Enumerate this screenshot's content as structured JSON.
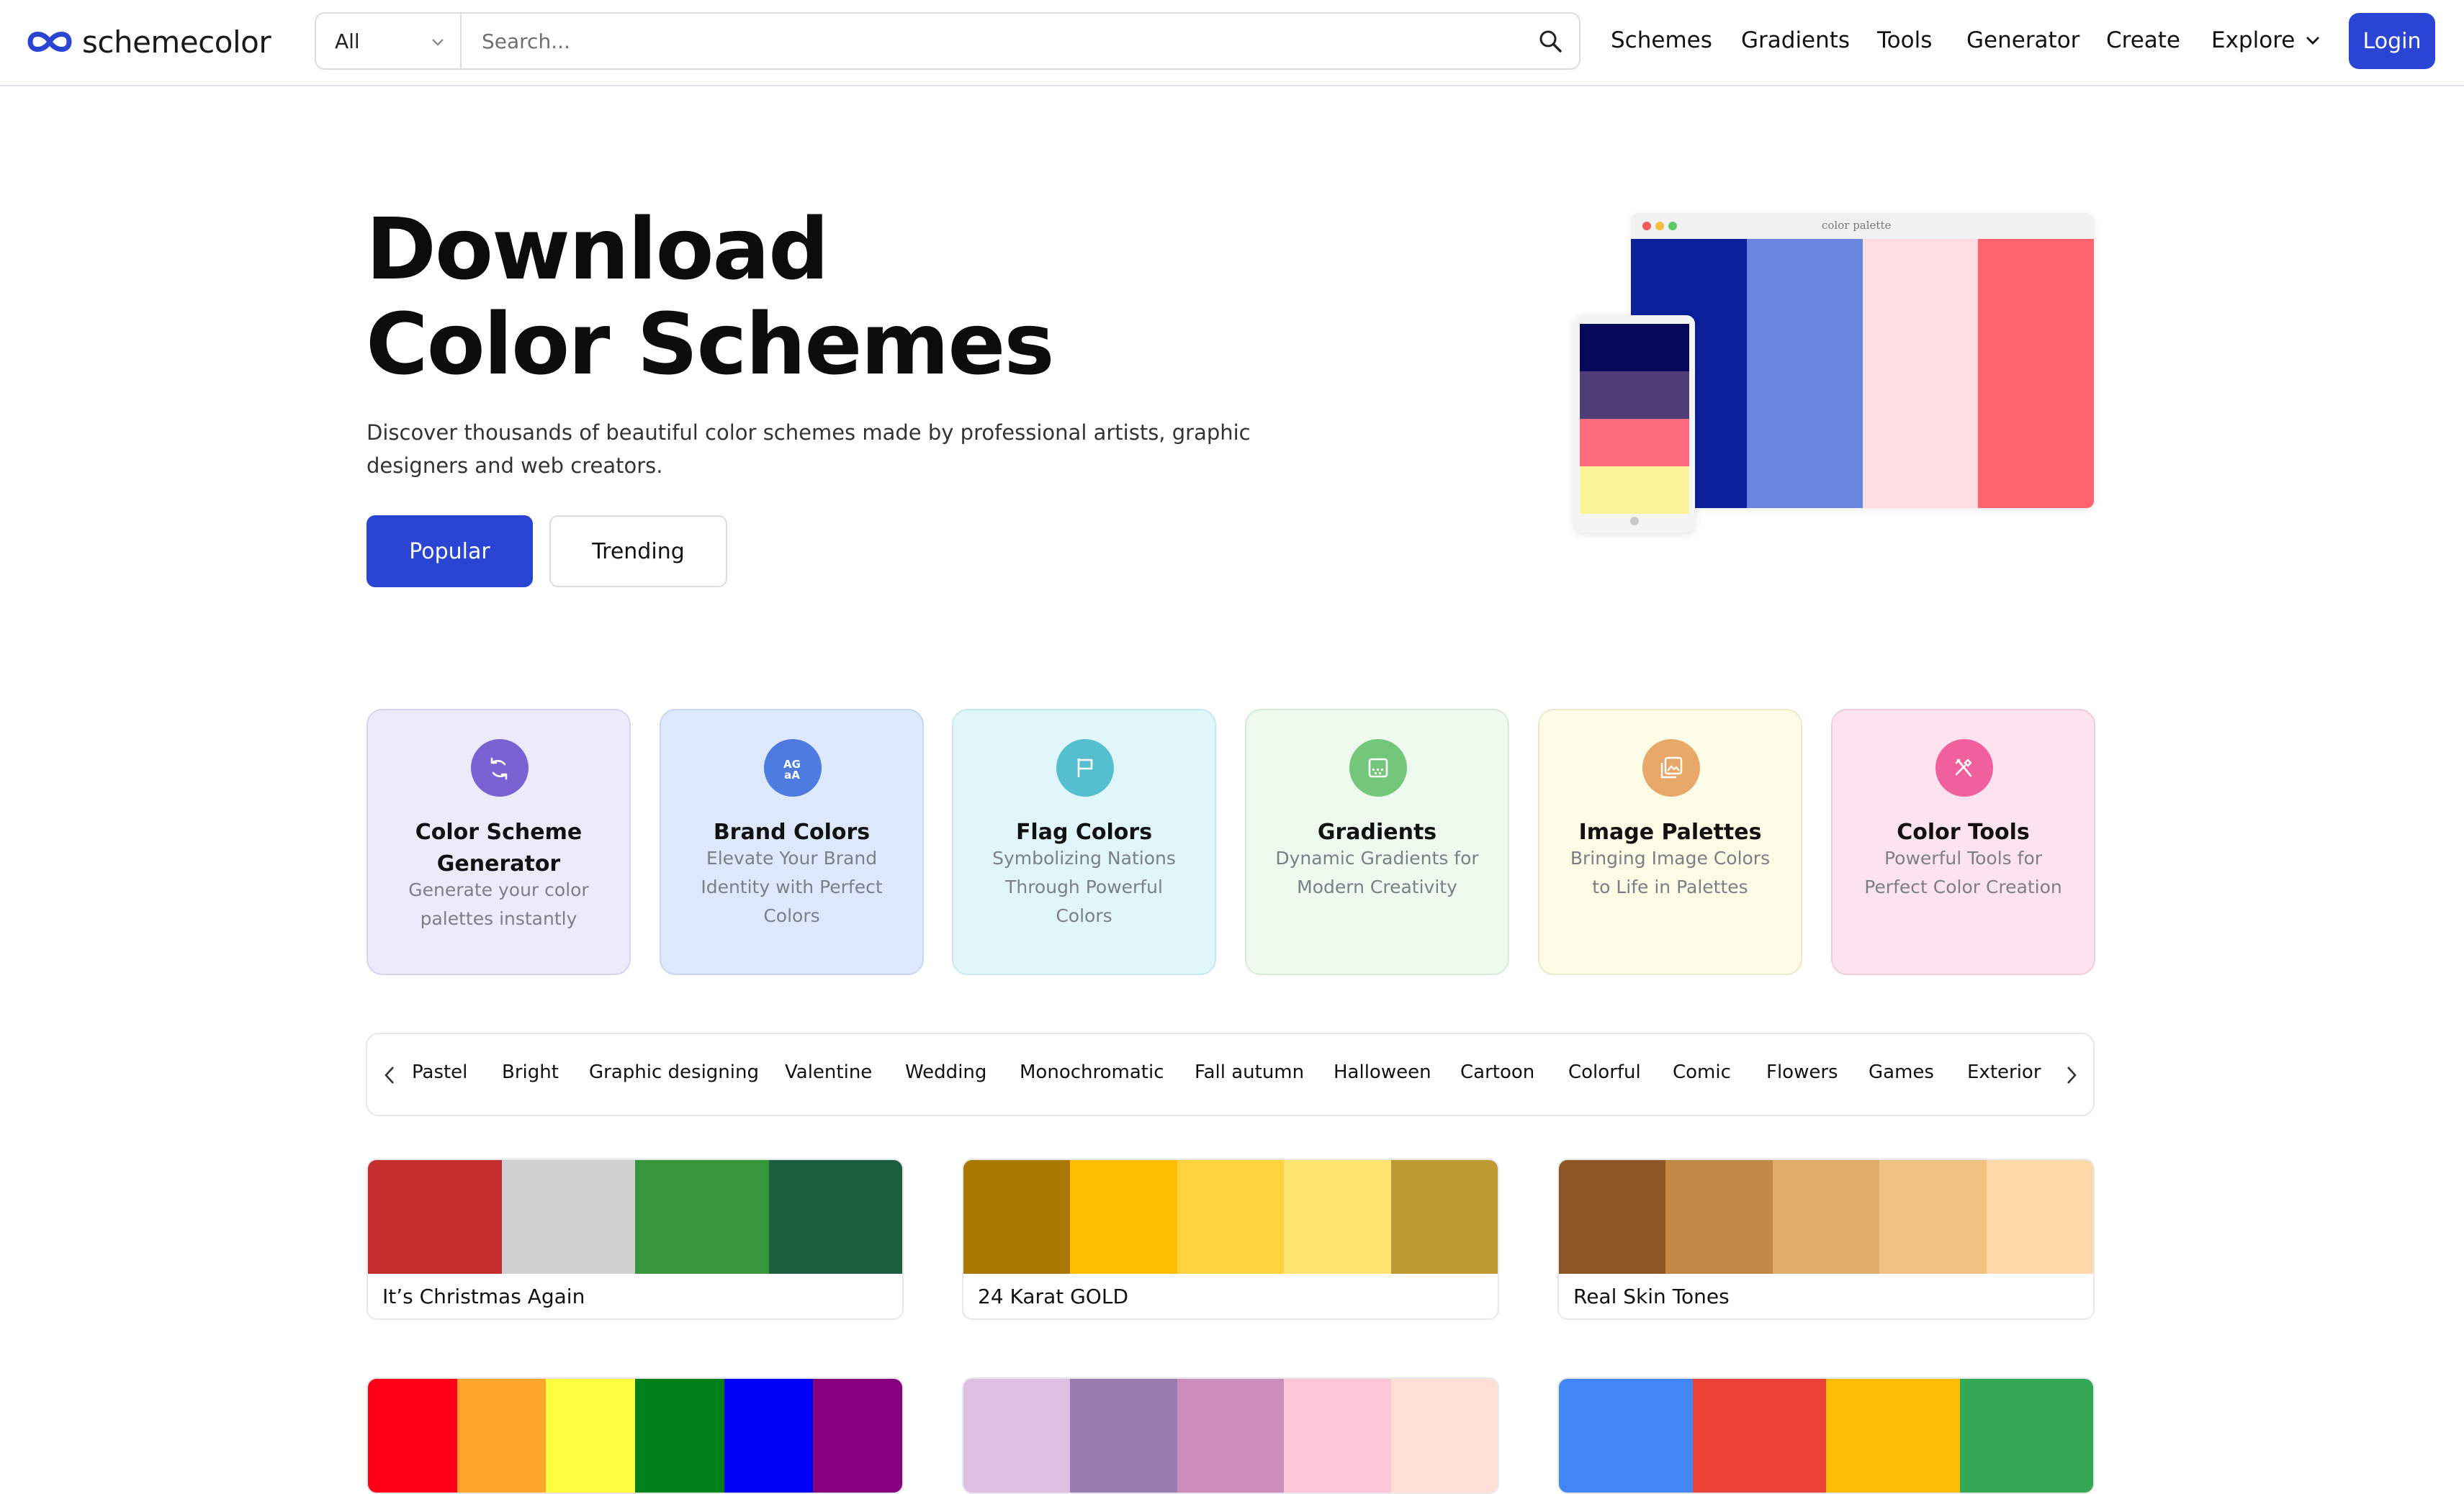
{
  "brand": {
    "logo_text": "schemecolor",
    "accent": "#2a44d3"
  },
  "search": {
    "category": "All",
    "placeholder": "Search..."
  },
  "nav": {
    "items": [
      "Schemes",
      "Gradients",
      "Tools",
      "Generator",
      "Create",
      "Explore"
    ],
    "login": "Login"
  },
  "hero": {
    "title_line1": "Download",
    "title_line2": "Color Schemes",
    "subtitle": "Discover thousands of beautiful color schemes made by professional artists, graphic designers and web creators.",
    "btn_popular": "Popular",
    "btn_trending": "Trending",
    "illustration_text": "color palette",
    "desktop_colors": [
      "#0b2199",
      "#6987e1",
      "#ffdde3",
      "#ff636e"
    ],
    "phone_colors": [
      "#07085a",
      "#4f3d78",
      "#ff6b7e",
      "#fbf39a"
    ]
  },
  "categories": [
    {
      "title": "Color Scheme Generator",
      "desc": "Generate your color palettes instantly",
      "icon": "refresh-icon",
      "bg": "#ecebfb",
      "border": "#d6d3f2",
      "icon_bg": "#7a62d2"
    },
    {
      "title": "Brand Colors",
      "desc": "Elevate Your Brand Identity with Perfect Colors",
      "icon": "font-icon",
      "bg": "#dde8fc",
      "border": "#c6d6f4",
      "icon_bg": "#4d7bdf"
    },
    {
      "title": "Flag Colors",
      "desc": "Symbolizing Nations Through Powerful Colors",
      "icon": "flag-icon",
      "bg": "#e1f6fa",
      "border": "#c6e9f0",
      "icon_bg": "#55bfd0"
    },
    {
      "title": "Gradients",
      "desc": "Dynamic Gradients for Modern Creativity",
      "icon": "gradient-icon",
      "bg": "#eefaee",
      "border": "#d6ecd6",
      "icon_bg": "#74c77a"
    },
    {
      "title": "Image Palettes",
      "desc": "Bringing Image Colors to Life in Palettes",
      "icon": "image-icon",
      "bg": "#fcfbe6",
      "border": "#ece9c9",
      "icon_bg": "#e8a86a"
    },
    {
      "title": "Color Tools",
      "desc": "Powerful Tools for Perfect Color Creation",
      "icon": "tools-icon",
      "bg": "#fde3ee",
      "border": "#f3ccdc",
      "icon_bg": "#f0609f"
    }
  ],
  "tags": [
    "Pastel",
    "Bright",
    "Graphic designing",
    "Valentine",
    "Wedding",
    "Monochromatic",
    "Fall autumn",
    "Halloween",
    "Cartoon",
    "Colorful",
    "Comic",
    "Flowers",
    "Games",
    "Exterior"
  ],
  "palettes": [
    {
      "name": "It’s Christmas Again",
      "colors": [
        "#c52d2e",
        "#d0d0d0",
        "#36973a",
        "#1b5e40"
      ]
    },
    {
      "name": "24 Karat GOLD",
      "colors": [
        "#a97800",
        "#fbbe00",
        "#fed43e",
        "#fee36f",
        "#bf9a33"
      ]
    },
    {
      "name": "Real Skin Tones",
      "colors": [
        "#8c5523",
        "#c38844",
        "#e1ab6a",
        "#efc27f",
        "#fed8a6"
      ]
    },
    {
      "name": "",
      "colors": [
        "#ff0018",
        "#ffa52c",
        "#ffff41",
        "#008018",
        "#0000f9",
        "#86007d"
      ]
    },
    {
      "name": "",
      "colors": [
        "#e0bde2",
        "#977cad",
        "#cd8dbc",
        "#ffc6d9",
        "#ffded4"
      ]
    },
    {
      "name": "",
      "colors": [
        "#4285f4",
        "#ea4335",
        "#fbbc05",
        "#34a853"
      ]
    }
  ]
}
